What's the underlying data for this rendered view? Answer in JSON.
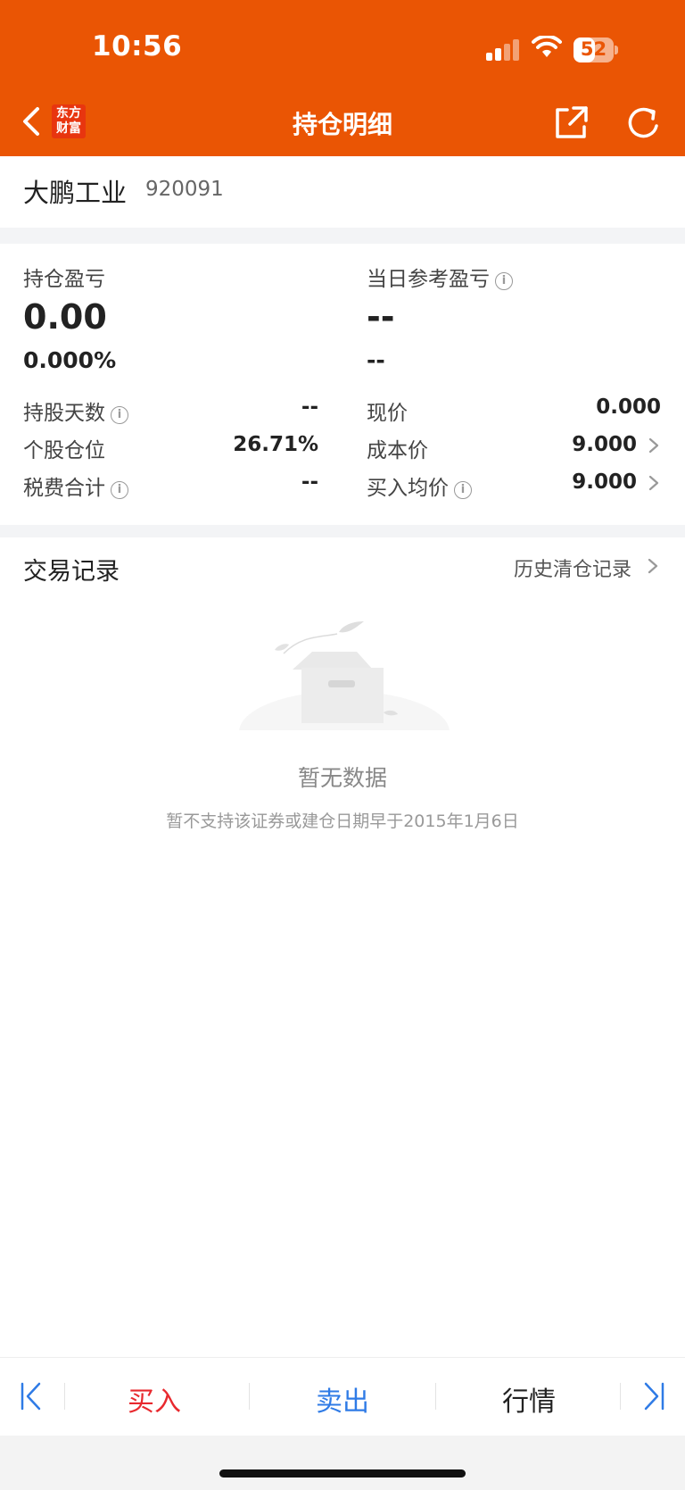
{
  "status_bar": {
    "time": "10:56",
    "battery": "52"
  },
  "nav": {
    "logo_line1": "东方",
    "logo_line2": "财富",
    "title": "持仓明细"
  },
  "stock": {
    "name": "大鹏工业",
    "code": "920091"
  },
  "summary": {
    "pnl_label": "持仓盈亏",
    "pnl_value": "0.00",
    "pnl_pct": "0.000%",
    "daily_label": "当日参考盈亏",
    "daily_value": "--",
    "daily_pct": "--",
    "rows_left": [
      {
        "label": "持股天数",
        "value": "--"
      },
      {
        "label": "个股仓位",
        "value": "26.71%"
      },
      {
        "label": "税费合计",
        "value": "--"
      }
    ],
    "rows_right": [
      {
        "label": "现价",
        "value": "0.000"
      },
      {
        "label": "成本价",
        "value": "9.000"
      },
      {
        "label": "买入均价",
        "value": "9.000"
      }
    ],
    "info_glyph": "i"
  },
  "records": {
    "title": "交易记录",
    "history_link": "历史清仓记录",
    "empty_title": "暂无数据",
    "empty_subtitle": "暂不支持该证券或建仓日期早于2015年1月6日"
  },
  "toolbar": {
    "buy": "买入",
    "sell": "卖出",
    "market": "行情"
  },
  "colors": {
    "brand": "#ea5504",
    "buy": "#e8292e",
    "sell": "#2f7be6"
  }
}
